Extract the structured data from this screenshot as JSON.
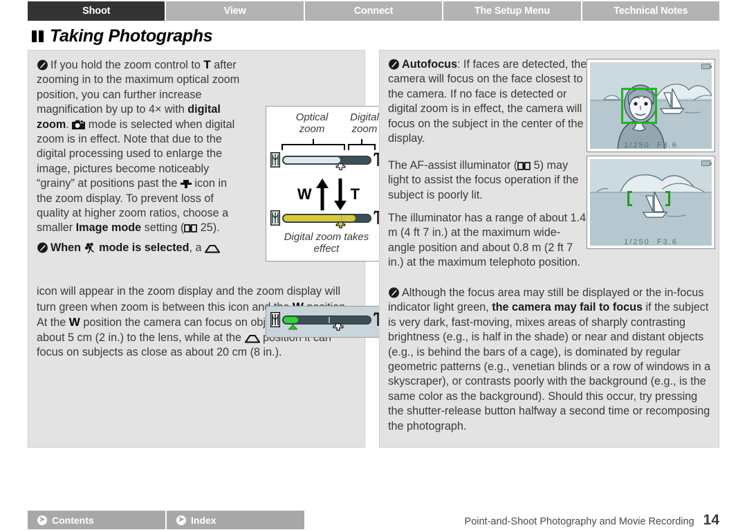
{
  "tabs": [
    {
      "label": "Shoot",
      "active": true
    },
    {
      "label": "View",
      "active": false
    },
    {
      "label": "Connect",
      "active": false
    },
    {
      "label": "The Setup Menu",
      "active": false
    },
    {
      "label": "Technical Notes",
      "active": false
    }
  ],
  "heading": {
    "title": "Taking Photographs"
  },
  "left": {
    "note1": {
      "p1_a": "If you hold the zoom control to ",
      "p1_T": "T",
      "p1_b": " after zooming in to the maximum optical zoom position, you can further increase magnification by up to 4× with ",
      "p1_bold": "digital zoom",
      "p1_c": ". ",
      "p1_d": " mode is selected when digital zoom is in effect. Note that due to the digital processing used to enlarge the image, pictures become noticeably “grainy” at positions past the ",
      "p1_e": " icon in the zoom display. To prevent loss of quality at higher zoom ratios, choose a smaller ",
      "p1_bold2": "Image mode",
      "p1_f": " setting (",
      "p1_ref": "25",
      "p1_g": ")."
    },
    "note2": {
      "p2_bold": "When",
      "p2_bold_tail": "mode is selected",
      "p2_a": ", a ",
      "p2_b": " icon will appear in the zoom display and the zoom display will turn green when zoom is between this icon and the ",
      "p2_W1": "W",
      "p2_c": " position. At the ",
      "p2_W2": "W",
      "p2_d": " position the camera can focus on objects as close as about 5 cm (2 in.) to the lens, while at the ",
      "p2_e": " position it can focus on subjects as close as about 20 cm (8 in.)."
    },
    "figure": {
      "label_optical": "Optical\nzoom",
      "label_digital": "Digital\nzoom",
      "label_effect": "Digital zoom takes\neffect",
      "wide_letter": "W",
      "tele_letter": "T",
      "bar_top_optical_pct": 64,
      "bar_top_digital_pct": 36,
      "bar_bottom_fill_pct": 82,
      "colors": {
        "bar_track": "#3c4f56",
        "optical_fill": "#dce8ec",
        "digital_fill": "#3c4f56",
        "macro_green": "#30c030",
        "digital_yellow": "#d8c936"
      }
    },
    "mini_figure": {
      "green_fill_pct": 16,
      "macro_marker_pct": 18,
      "digital_marker_pct": 60
    }
  },
  "right": {
    "note1": {
      "bold": "Autofocus",
      "text": ": If faces are detected, the camera will focus on the face closest to the camera. If no face is detected or digital zoom is in effect, the camera will focus on the subject in the center of the display."
    },
    "note1_p2_a": "The AF-assist illuminator (",
    "note1_p2_ref": "5",
    "note1_p2_b": ") may light to assist the focus operation if the subject is poorly lit.",
    "note1_p3": "The illuminator has a range of about 1.4 m (4 ft 7 in.) at the maximum wide-angle position and about 0.8 m (2 ft 7 in.) at the maximum telephoto position.",
    "note2": {
      "a": "Although the focus area may still be displayed or the in-focus indicator light green, ",
      "bold": "the camera may fail to focus",
      "b": " if the subject is very dark, fast-moving, mixes areas of sharply contrasting brightness (e.g., is half in the shade) or near and distant objects (e.g., is behind the bars of a cage), is dominated by regular geometric patterns (e.g., venetian blinds or a row of windows in a skyscraper), or contrasts poorly with the background (e.g., is the same color as the background). Should this occur, try pressing the shutter-release button halfway a second time or recomposing the photograph."
    },
    "monitor1": {
      "shutter": "1/250",
      "aperture": "F3.6"
    },
    "monitor2": {
      "shutter": "1/250",
      "aperture": "F3.6"
    }
  },
  "footer": {
    "contents_label": "Contents",
    "index_label": "Index",
    "section": "Point-and-Shoot Photography and Movie Recording",
    "page_number": "14"
  },
  "colors": {
    "tab_active": "#333333",
    "tab_inactive": "#b3b3b3",
    "panel_bg": "#e3e3e3",
    "focus_green": "#21b421",
    "footer_btn": "#a8a8a8"
  }
}
